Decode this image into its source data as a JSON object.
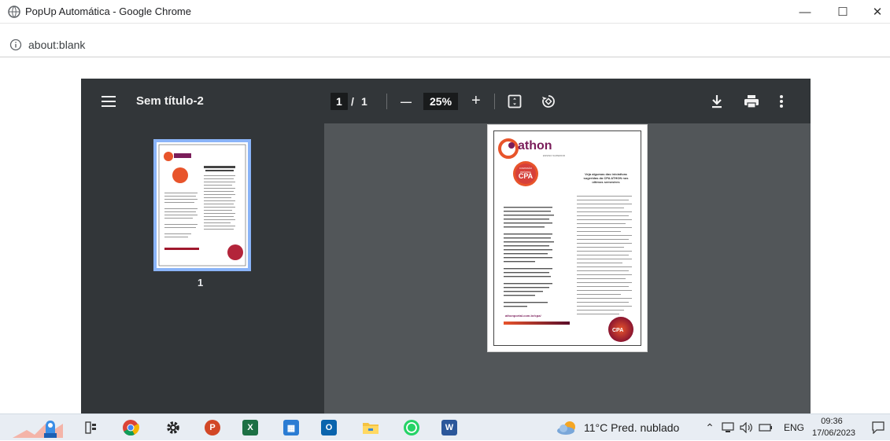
{
  "window": {
    "title": "PopUp Automática - Google Chrome",
    "minimize": "—",
    "maximize": "☐",
    "close": "✕"
  },
  "address_bar": {
    "url": "about:blank"
  },
  "pdf_viewer": {
    "doc_title": "Sem título-2",
    "current_page": "1",
    "page_separator": "/",
    "total_pages": "1",
    "zoom": "25%",
    "zoom_out": "—",
    "zoom_in": "+",
    "thumbnail_label": "1"
  },
  "document": {
    "brand": "athon",
    "brand_sub": "ENSINO SUPERIOR",
    "badge_top": "COMISSÃO PRÓPRIA",
    "badge": "CPA",
    "heading": "Veja algumas das iniciativas sugeridas da CPA ATHON nos últimos semestres",
    "url": "athonportal.com.br/cpa/"
  },
  "taskbar": {
    "weather": "11°C  Pred. nublado",
    "language": "ENG",
    "time": "09:36",
    "date": "17/06/2023"
  },
  "colors": {
    "toolbar": "#323639",
    "viewer_bg": "#525659",
    "thumb_highlight": "#8ab4f8",
    "taskbar": "#e8edf3",
    "brand_orange": "#e8542b",
    "brand_purple": "#7a1d5a"
  }
}
